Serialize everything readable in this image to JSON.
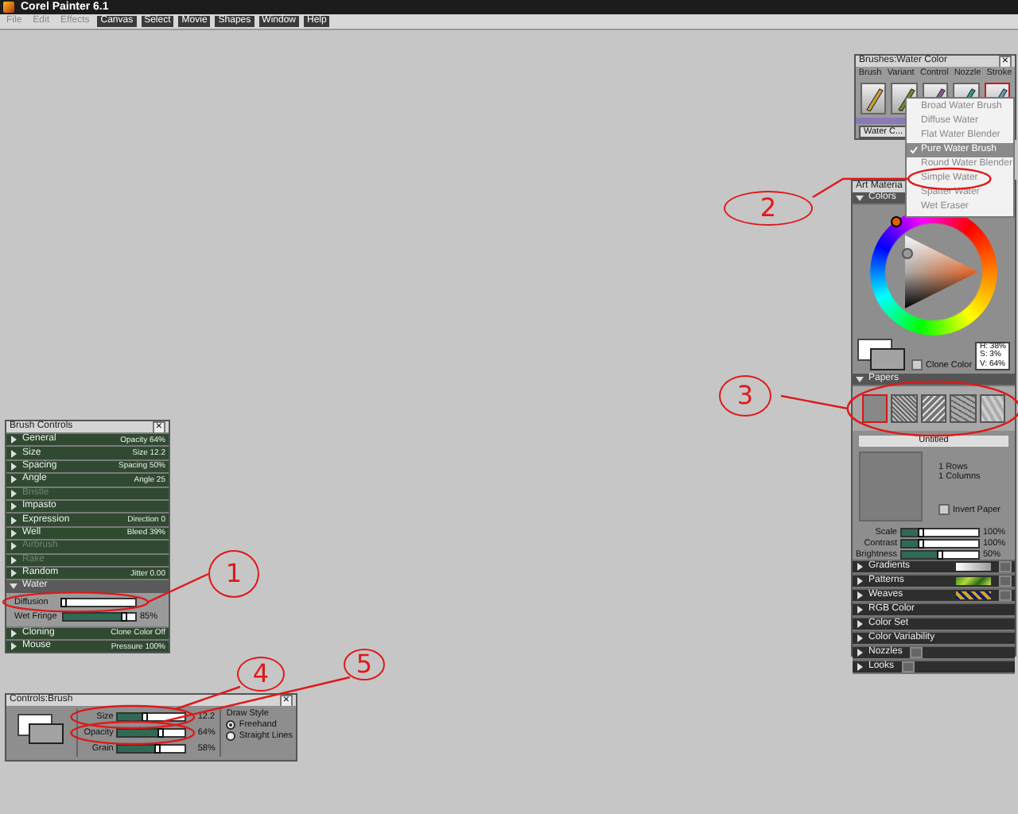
{
  "app": {
    "title": "Corel Painter 6.1"
  },
  "menu": [
    {
      "label": "File",
      "disabled": true
    },
    {
      "label": "Edit",
      "disabled": true
    },
    {
      "label": "Effects",
      "disabled": true
    },
    {
      "label": "Canvas",
      "disabled": false
    },
    {
      "label": "Select",
      "disabled": false
    },
    {
      "label": "Movie",
      "disabled": false
    },
    {
      "label": "Shapes",
      "disabled": false
    },
    {
      "label": "Window",
      "disabled": false
    },
    {
      "label": "Help",
      "disabled": false
    }
  ],
  "brushes_panel": {
    "title": "Brushes:Water Color",
    "close": "×",
    "tabs": [
      "Brush",
      "Variant",
      "Control",
      "Nozzle",
      "Stroke"
    ],
    "brushes": [
      {
        "selected": false
      },
      {
        "selected": false
      },
      {
        "selected": false
      },
      {
        "selected": false
      },
      {
        "selected": true
      }
    ],
    "category": "Water C...",
    "variants": [
      {
        "label": "Broad Water Brush",
        "selected": false
      },
      {
        "label": "Diffuse Water",
        "selected": false
      },
      {
        "label": "Flat Water Blender",
        "selected": false
      },
      {
        "label": "Pure Water Brush",
        "selected": true
      },
      {
        "label": "Round Water Blender",
        "selected": false
      },
      {
        "label": "Simple Water",
        "selected": false
      },
      {
        "label": "Spatter Water",
        "selected": false
      },
      {
        "label": "Wet Eraser",
        "selected": false
      }
    ]
  },
  "art_materials": {
    "title": "Art Materia",
    "colors": {
      "title": "Colors",
      "expanded": true,
      "readout": [
        "H: 38%",
        "S: 3%",
        "V: 64%"
      ],
      "clone_color": {
        "label": "Clone Color",
        "checked": false
      }
    },
    "papers": {
      "title": "Papers",
      "expanded": true,
      "swatches": [
        {
          "selected": true
        },
        {
          "selected": false
        },
        {
          "selected": false
        },
        {
          "selected": false
        },
        {
          "selected": false
        }
      ],
      "name": "Untitled",
      "rows": "1 Rows",
      "columns": "1 Columns",
      "invert_paper": {
        "label": "Invert Paper",
        "checked": false
      },
      "sliders": [
        {
          "label": "Scale",
          "level": 0.25,
          "reading": "100%"
        },
        {
          "label": "Contrast",
          "level": 0.25,
          "reading": "100%"
        },
        {
          "label": "Brightness",
          "level": 0.5,
          "reading": "50%"
        }
      ]
    },
    "sections": [
      {
        "label": "Gradients",
        "kind": "preview"
      },
      {
        "label": "Patterns",
        "kind": "preview"
      },
      {
        "label": "Weaves",
        "kind": "preview"
      },
      {
        "label": "RGB Color",
        "kind": "plain"
      },
      {
        "label": "Color Set",
        "kind": "plain"
      },
      {
        "label": "Color Variability",
        "kind": "plain"
      },
      {
        "label": "Nozzles",
        "kind": "button"
      },
      {
        "label": "Looks",
        "kind": "button"
      }
    ]
  },
  "brush_controls": {
    "title": "Brush Controls",
    "close": "×",
    "sections": [
      {
        "label": "General",
        "reading": "Opacity 64%",
        "disabled": false,
        "expanded": false
      },
      {
        "label": "Size",
        "reading": "Size 12.2",
        "disabled": false,
        "expanded": false
      },
      {
        "label": "Spacing",
        "reading": "Spacing 50%",
        "disabled": false,
        "expanded": false
      },
      {
        "label": "Angle",
        "reading": "Angle 25",
        "disabled": false,
        "expanded": false
      },
      {
        "label": "Bristle",
        "disabled": true,
        "expanded": false
      },
      {
        "label": "Impasto",
        "disabled": false,
        "expanded": false
      },
      {
        "label": "Expression",
        "reading": "Direction 0",
        "disabled": false,
        "expanded": false
      },
      {
        "label": "Well",
        "reading": "Bleed 39%",
        "disabled": false,
        "expanded": false
      },
      {
        "label": "Airbrush",
        "disabled": true,
        "expanded": false
      },
      {
        "label": "Rake",
        "disabled": true,
        "expanded": false
      },
      {
        "label": "Random",
        "reading": "Jitter 0.00",
        "disabled": false,
        "expanded": false
      },
      {
        "label": "Water",
        "disabled": false,
        "expanded": true,
        "sliders": [
          {
            "label": "Diffusion",
            "level": 0.0
          },
          {
            "label": "Wet Fringe",
            "level": 0.85,
            "reading": "85%"
          }
        ]
      },
      {
        "label": "Cloning",
        "reading": "Clone Color Off",
        "disabled": false,
        "expanded": false
      },
      {
        "label": "Mouse",
        "reading": "Pressure 100%",
        "disabled": false,
        "expanded": false
      }
    ]
  },
  "controls_brush": {
    "title": "Controls:Brush",
    "close": "×",
    "sliders": [
      {
        "label": "Size",
        "level": 0.4,
        "reading": "12.2"
      },
      {
        "label": "Opacity",
        "level": 0.64,
        "reading": "64%"
      },
      {
        "label": "Grain",
        "level": 0.58,
        "reading": "58%"
      }
    ],
    "draw_style": {
      "title": "Draw Style",
      "options": [
        {
          "label": "Freehand",
          "selected": true
        },
        {
          "label": "Straight Lines",
          "selected": false
        }
      ]
    }
  },
  "annotations": [
    {
      "label": "1"
    },
    {
      "label": "2"
    },
    {
      "label": "3"
    },
    {
      "label": "4"
    },
    {
      "label": "5"
    }
  ]
}
